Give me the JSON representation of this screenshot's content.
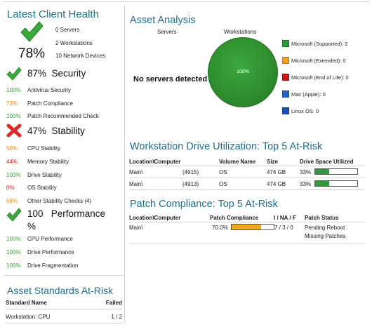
{
  "left": {
    "title": "Latest Client Health",
    "servers": "0 Servers",
    "workstations": "2 Workstations",
    "network_devices": "10 Network Devices",
    "overall_pct": "78%",
    "sections": {
      "security": {
        "percent": "87%",
        "label": "Security",
        "status": "pass",
        "rows": [
          {
            "pct": "100%",
            "label": "Antivirus Security",
            "color": "#35a035"
          },
          {
            "pct": "73%",
            "label": "Patch Compliance",
            "color": "#e08a1e"
          },
          {
            "pct": "100%",
            "label": "Patch Recommended Check",
            "color": "#35a035"
          }
        ]
      },
      "stability": {
        "percent": "47%",
        "label": "Stability",
        "status": "fail",
        "rows": [
          {
            "pct": "50%",
            "label": "CPU Stability",
            "color": "#e08a1e"
          },
          {
            "pct": "44%",
            "label": "Memory Stability",
            "color": "#d42020"
          },
          {
            "pct": "100%",
            "label": "Drive Stability",
            "color": "#35a035"
          },
          {
            "pct": "0%",
            "label": "OS Stability",
            "color": "#d42020"
          },
          {
            "pct": "68%",
            "label": "Other Stability Checks (4)",
            "color": "#e08a1e"
          }
        ]
      },
      "performance": {
        "percent": "100 %",
        "label": "Performance",
        "status": "pass",
        "rows": [
          {
            "pct": "100%",
            "label": "CPU Performance",
            "color": "#35a035"
          },
          {
            "pct": "100%",
            "label": "Drive Performance",
            "color": "#35a035"
          },
          {
            "pct": "100%",
            "label": "Drive Fragmentation",
            "color": "#35a035"
          }
        ]
      }
    },
    "asset_standards": {
      "title": "Asset Standards At-Risk",
      "col_standard": "Standard Name",
      "col_failed": "Failed",
      "rows": [
        {
          "name": "Workstation: CPU",
          "failed": "1 / 2"
        }
      ]
    }
  },
  "asset_analysis": {
    "title": "Asset Analysis",
    "servers_label": "Servers",
    "workstations_label": "Workstations",
    "no_servers": "No servers detected",
    "pie_label": "100%",
    "legend": [
      {
        "label": "Microsoft (Supported): 2",
        "color": "#2e9a3a"
      },
      {
        "label": "Microsoft (Extended): 0",
        "color": "#f0a030"
      },
      {
        "label": "Microsoft (End of Life): 0",
        "color": "#c81818"
      },
      {
        "label": "Mac (Apple): 0",
        "color": "#2a5fc0"
      },
      {
        "label": "Linux OS: 0",
        "color": "#1a4fb8"
      }
    ]
  },
  "drive_util": {
    "title": "Workstation Drive Utilization: Top 5 At-Risk",
    "headers": {
      "location": "Location\\Computer",
      "volume": "Volume Name",
      "size": "Size",
      "space": "Drive Space Utilized"
    },
    "rows": [
      {
        "location": "Main\\",
        "computer": "(4915)",
        "volume": "OS",
        "size": "474 GB",
        "pct_text": "33%",
        "pct": 33
      },
      {
        "location": "Main\\",
        "computer": "(4913)",
        "volume": "OS",
        "size": "474 GB",
        "pct_text": "33%",
        "pct": 33
      }
    ],
    "bar_color": "#2e9a3a"
  },
  "patch": {
    "title": "Patch Compliance: Top 5 At-Risk",
    "headers": {
      "location": "Location\\Computer",
      "compliance": "Patch Compliance",
      "ina": "I / NA / F",
      "status": "Patch Status"
    },
    "rows": [
      {
        "location": "Main\\",
        "pct_text": "70.0%",
        "pct": 70,
        "ina": "7 / 3 / 0",
        "status_line1": "Pending Reboot",
        "status_line2": "Missing Patches"
      }
    ],
    "bar_color": "#f0a820"
  }
}
